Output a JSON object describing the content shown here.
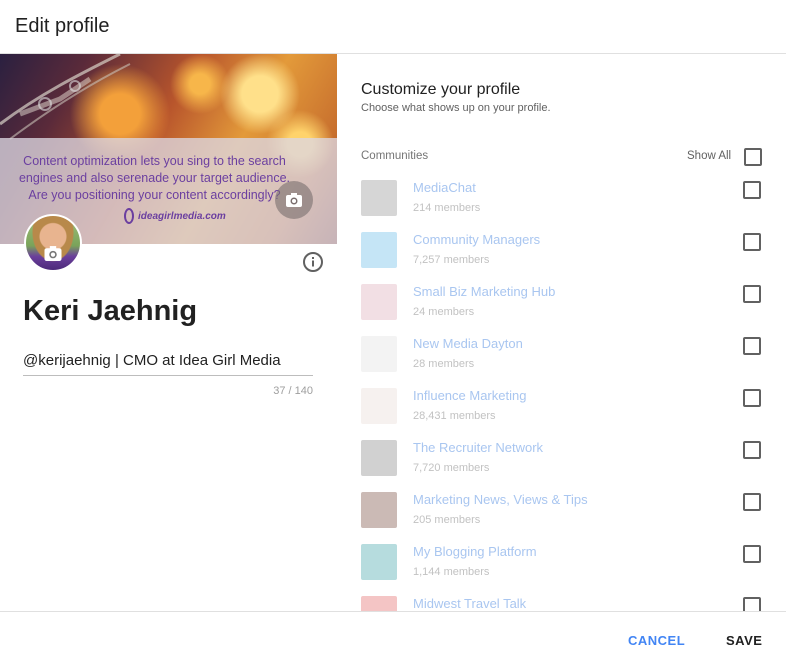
{
  "dialog": {
    "title": "Edit profile"
  },
  "cover": {
    "line1": "Content optimization lets you sing to the search",
    "line2": "engines and also serenade your target audience.",
    "line3": "Are you positioning your content accordingly?",
    "brand": "ideagirlmedia.com"
  },
  "profile": {
    "name": "Keri Jaehnig",
    "tagline": "@kerijaehnig | CMO at Idea Girl Media",
    "char_count": "37 / 140"
  },
  "customize": {
    "title": "Customize your profile",
    "subtitle": "Choose what shows up on your profile.",
    "communities_label": "Communities",
    "show_all_label": "Show All"
  },
  "communities": [
    {
      "name": "MediaChat",
      "members": "214 members",
      "thumb_color": "#8a8a8a"
    },
    {
      "name": "Community Managers",
      "members": "7,257 members",
      "thumb_color": "#5ab4e6"
    },
    {
      "name": "Small Biz Marketing Hub",
      "members": "24 members",
      "thumb_color": "#d9a3b3"
    },
    {
      "name": "New Media Dayton",
      "members": "28 members",
      "thumb_color": "#dcdcdc"
    },
    {
      "name": "Influence Marketing",
      "members": "28,431 members",
      "thumb_color": "#e6d8d0"
    },
    {
      "name": "The Recruiter Network",
      "members": "7,720 members",
      "thumb_color": "#7a7a7a"
    },
    {
      "name": "Marketing News, Views & Tips",
      "members": "205 members",
      "thumb_color": "#6b3a2a"
    },
    {
      "name": "My Blogging Platform",
      "members": "1,144 members",
      "thumb_color": "#2e9aa0"
    },
    {
      "name": "Midwest Travel Talk",
      "members": "",
      "thumb_color": "#e05a5a"
    }
  ],
  "footer": {
    "cancel_label": "CANCEL",
    "save_label": "SAVE"
  },
  "colors": {
    "accent": "#4285f4",
    "community_link": "#a9c6f0"
  }
}
